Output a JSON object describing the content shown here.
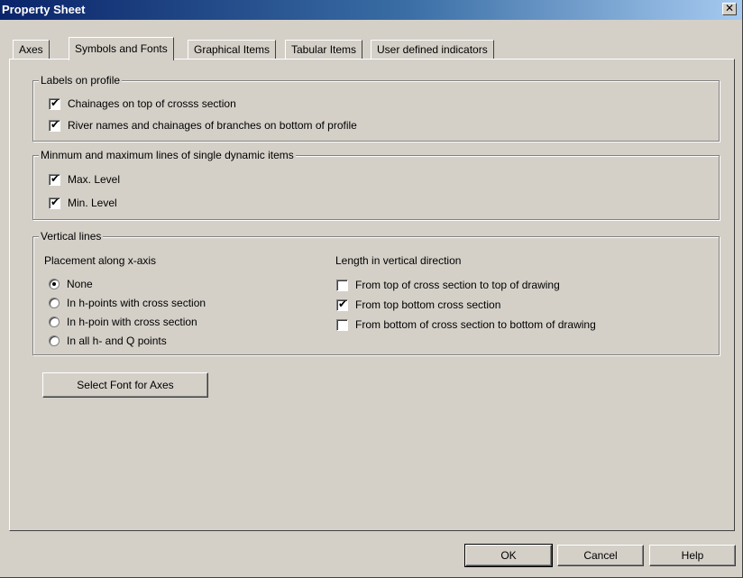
{
  "window": {
    "title": "Property Sheet",
    "close_glyph": "✕"
  },
  "tabs": [
    {
      "label": "Axes"
    },
    {
      "label": "Symbols and Fonts",
      "active": true
    },
    {
      "label": "Graphical Items"
    },
    {
      "label": "Tabular Items"
    },
    {
      "label": "User defined indicators"
    }
  ],
  "labels_on_profile": {
    "title": "Labels on profile",
    "items": [
      {
        "label": "Chainages on top of crosss section",
        "checked": true
      },
      {
        "label": "River names and chainages of branches on bottom of profile",
        "checked": true
      }
    ]
  },
  "minmax": {
    "title": "Minmum and maximum lines of single dynamic items",
    "items": [
      {
        "label": "Max. Level",
        "checked": true
      },
      {
        "label": "Min. Level",
        "checked": true
      }
    ]
  },
  "vertical_lines": {
    "title": "Vertical lines",
    "placement_title": "Placement along x-axis",
    "placement_options": [
      {
        "label": "None",
        "selected": true
      },
      {
        "label": "In h-points with cross section",
        "selected": false
      },
      {
        "label": "In h-poin with cross section",
        "selected": false
      },
      {
        "label": "In all h- and Q points",
        "selected": false
      }
    ],
    "length_title": "Length in vertical direction",
    "length_options": [
      {
        "label": "From top of cross section to top of drawing",
        "checked": false
      },
      {
        "label": "From top bottom cross section",
        "checked": true
      },
      {
        "label": "From bottom of cross section to bottom of drawing",
        "checked": false
      }
    ]
  },
  "select_font_button": "Select Font for Axes",
  "footer": {
    "ok": "OK",
    "cancel": "Cancel",
    "help": "Help"
  },
  "check_glyph": "✔"
}
